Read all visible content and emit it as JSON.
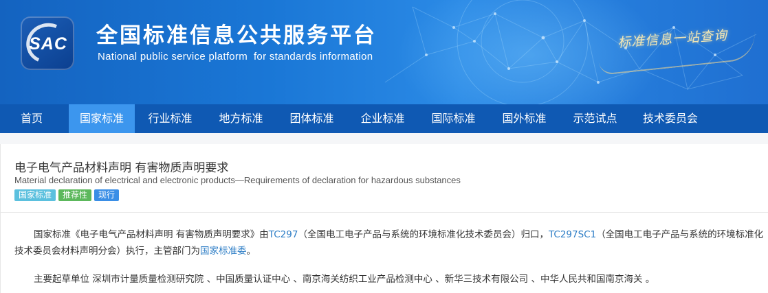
{
  "header": {
    "logo_text": "SAC",
    "title": "全国标准信息公共服务平台",
    "subtitle": "National public service platform  for standards information",
    "slogan": "标准信息一站查询"
  },
  "nav": {
    "items": [
      {
        "label": "首页"
      },
      {
        "label": "国家标准",
        "active": true
      },
      {
        "label": "行业标准"
      },
      {
        "label": "地方标准"
      },
      {
        "label": "团体标准"
      },
      {
        "label": "企业标准"
      },
      {
        "label": "国际标准"
      },
      {
        "label": "国外标准"
      },
      {
        "label": "示范试点"
      },
      {
        "label": "技术委员会"
      }
    ]
  },
  "standard": {
    "title_cn": "电子电气产品材料声明 有害物质声明要求",
    "title_en": "Material declaration of electrical and electronic products—Requirements of declaration for hazardous substances",
    "badges": [
      "国家标准",
      "推荐性",
      "现行"
    ]
  },
  "description": {
    "p1_part1": "国家标准《电子电气产品材料声明 有害物质声明要求》由",
    "p1_link1": "TC297",
    "p1_part2": "（全国电工电子产品与系统的环境标准化技术委员会）归口，",
    "p1_link2": "TC297SC1",
    "p1_part3": "（全国电工电子产品与系统的环境标准化技术委员会材料声明分会）执行，主管部门为",
    "p1_link3": "国家标准委",
    "p1_part4": "。",
    "p2": "主要起草单位 深圳市计量质量检测研究院 、中国质量认证中心 、南京海关纺织工业产品检测中心 、新华三技术有限公司 、中华人民共和国南京海关 。"
  },
  "colors": {
    "nav_bg": "#0f59b3",
    "nav_active": "#3c96ee",
    "link": "#2e7ec6",
    "badge_national": "#5bc0de",
    "badge_recommended": "#5cb85c",
    "badge_current": "#3a8ee6"
  }
}
